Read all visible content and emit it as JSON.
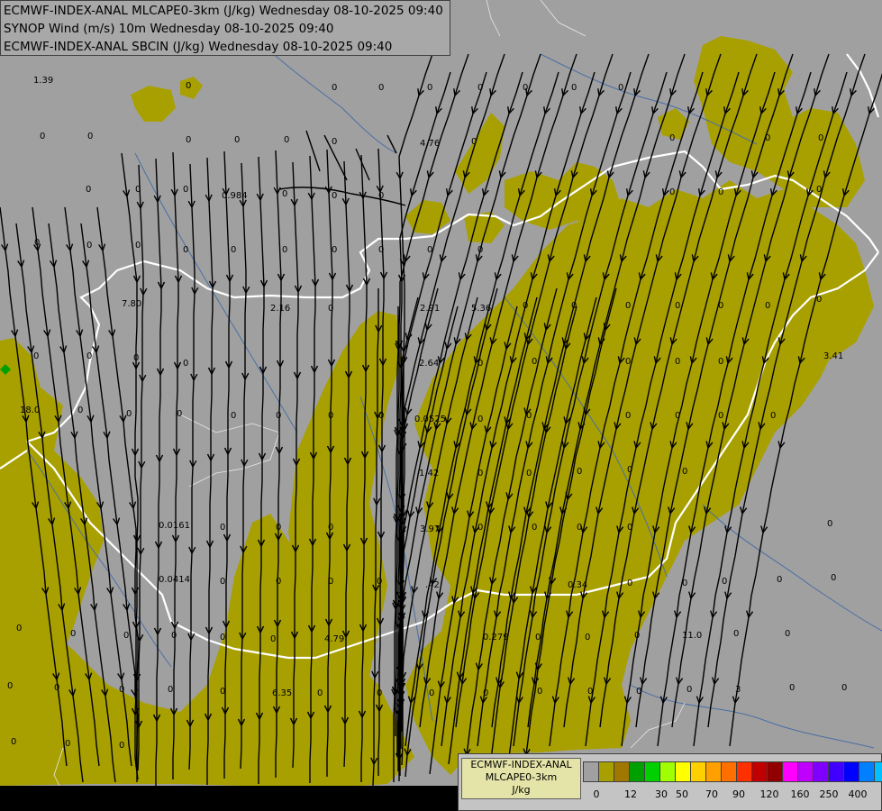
{
  "header": {
    "line1": "ECMWF-INDEX-ANAL MLCAPE0-3km (J/kg) Wednesday 08-10-2025 09:40",
    "line2": "SYNOP Wind (m/s) 10m Wednesday 08-10-2025 09:40",
    "line3": "ECMWF-INDEX-ANAL SBCIN (J/kg) Wednesday 08-10-2025 09:40"
  },
  "legend": {
    "title1": "ECMWF-INDEX-ANAL",
    "title2": "MLCAPE0-3km",
    "unit": "J/kg",
    "colors": [
      "#a0a0a0",
      "#a8a000",
      "#a07800",
      "#00a000",
      "#00d000",
      "#a0ff00",
      "#ffff00",
      "#ffd000",
      "#ffa000",
      "#ff7000",
      "#ff3000",
      "#c00000",
      "#900000",
      "#ff00ff",
      "#c000ff",
      "#8000ff",
      "#4000ff",
      "#0000ff",
      "#0080ff",
      "#00c0ff",
      "#00ffff",
      "#80ffff",
      "#ffffff"
    ],
    "ticks": [
      "0",
      "12",
      "30",
      "50",
      "70",
      "90",
      "120",
      "160",
      "250",
      "400"
    ]
  },
  "map": {
    "cape_color": "#a8a000",
    "background_color": "#a0a0a0",
    "border_color": "#ffffff",
    "river_color": "#4a6fa5",
    "station_marker_color": "#00a000",
    "station_values": [
      {
        "t": "1.39"
      },
      {
        "t": "0"
      },
      {
        "t": "0"
      },
      {
        "t": "0"
      },
      {
        "t": "0"
      },
      {
        "t": "0"
      },
      {
        "t": "0"
      },
      {
        "t": "0"
      },
      {
        "t": "0"
      },
      {
        "t": "0"
      },
      {
        "t": "0"
      },
      {
        "t": "0"
      },
      {
        "t": "0"
      },
      {
        "t": "0"
      },
      {
        "t": "0"
      },
      {
        "t": "4.76"
      },
      {
        "t": "0"
      },
      {
        "t": "0"
      },
      {
        "t": "0"
      },
      {
        "t": "0"
      },
      {
        "t": "0"
      },
      {
        "t": "0"
      },
      {
        "t": "0"
      },
      {
        "t": "0.984"
      },
      {
        "t": "0"
      },
      {
        "t": "0"
      },
      {
        "t": "0"
      },
      {
        "t": "0"
      },
      {
        "t": "0"
      },
      {
        "t": "0"
      },
      {
        "t": "0"
      },
      {
        "t": "0"
      },
      {
        "t": "0"
      },
      {
        "t": "0"
      },
      {
        "t": "0"
      },
      {
        "t": "0"
      },
      {
        "t": "0"
      },
      {
        "t": "0"
      },
      {
        "t": "0"
      },
      {
        "t": "0"
      },
      {
        "t": "7.80"
      },
      {
        "t": "2.16"
      },
      {
        "t": "0"
      },
      {
        "t": "2.91"
      },
      {
        "t": "5.36"
      },
      {
        "t": "0"
      },
      {
        "t": "0"
      },
      {
        "t": "0"
      },
      {
        "t": "0"
      },
      {
        "t": "0"
      },
      {
        "t": "0"
      },
      {
        "t": "0"
      },
      {
        "t": "0"
      },
      {
        "t": "0"
      },
      {
        "t": "0"
      },
      {
        "t": "0"
      },
      {
        "t": "2.64"
      },
      {
        "t": "0"
      },
      {
        "t": "0"
      },
      {
        "t": "0"
      },
      {
        "t": "0"
      },
      {
        "t": "0"
      },
      {
        "t": "3.41"
      },
      {
        "t": "18.0"
      },
      {
        "t": "0"
      },
      {
        "t": "0"
      },
      {
        "t": "0"
      },
      {
        "t": "0"
      },
      {
        "t": "0"
      },
      {
        "t": "0"
      },
      {
        "t": "0.0525"
      },
      {
        "t": "0"
      },
      {
        "t": "0"
      },
      {
        "t": "0"
      },
      {
        "t": "0"
      },
      {
        "t": "0"
      },
      {
        "t": "0"
      },
      {
        "t": "0"
      },
      {
        "t": "1.42"
      },
      {
        "t": "0"
      },
      {
        "t": "0"
      },
      {
        "t": "0"
      },
      {
        "t": "0"
      },
      {
        "t": "0"
      },
      {
        "t": "0.0161"
      },
      {
        "t": "0"
      },
      {
        "t": "0"
      },
      {
        "t": "0"
      },
      {
        "t": "3.97"
      },
      {
        "t": "0"
      },
      {
        "t": "0"
      },
      {
        "t": "0"
      },
      {
        "t": "0"
      },
      {
        "t": "0.0414"
      },
      {
        "t": "0"
      },
      {
        "t": "0"
      },
      {
        "t": "0"
      },
      {
        "t": "0"
      },
      {
        "t": ".42"
      },
      {
        "t": "0.34"
      },
      {
        "t": "0"
      },
      {
        "t": "0"
      },
      {
        "t": "0"
      },
      {
        "t": "0"
      },
      {
        "t": "0"
      },
      {
        "t": "0"
      },
      {
        "t": "0"
      },
      {
        "t": "0"
      },
      {
        "t": "0"
      },
      {
        "t": "0"
      },
      {
        "t": "0"
      },
      {
        "t": "4.79"
      },
      {
        "t": "0.279"
      },
      {
        "t": "0"
      },
      {
        "t": "0"
      },
      {
        "t": "0"
      },
      {
        "t": "11.0"
      },
      {
        "t": "0"
      },
      {
        "t": "0"
      },
      {
        "t": "0"
      },
      {
        "t": "0"
      },
      {
        "t": "0"
      },
      {
        "t": "0"
      },
      {
        "t": "0"
      },
      {
        "t": "0"
      },
      {
        "t": "6.35"
      },
      {
        "t": "0"
      },
      {
        "t": "0"
      },
      {
        "t": "0"
      },
      {
        "t": "0"
      },
      {
        "t": "0"
      },
      {
        "t": "0"
      },
      {
        "t": "0"
      },
      {
        "t": "0"
      },
      {
        "t": "3"
      },
      {
        "t": "0"
      },
      {
        "t": "0"
      },
      {
        "t": "0"
      },
      {
        "t": "0"
      },
      {
        "t": "0"
      }
    ]
  }
}
